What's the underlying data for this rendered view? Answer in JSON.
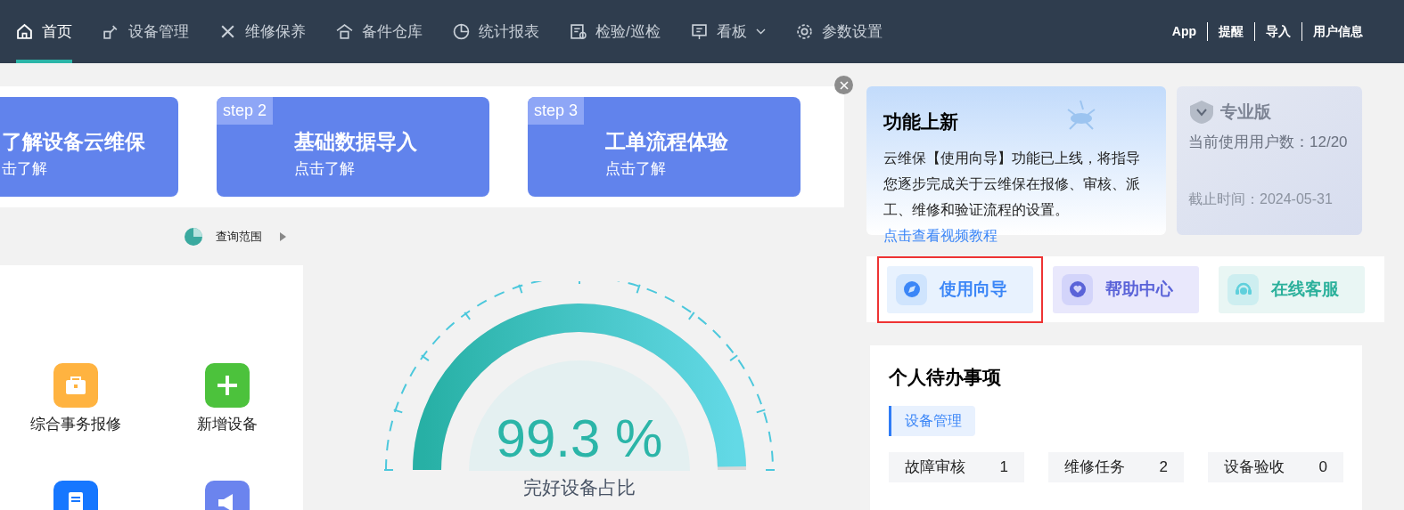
{
  "nav": {
    "items": [
      {
        "label": "首页",
        "selected": true,
        "dropdown": false
      },
      {
        "label": "设备管理",
        "selected": false,
        "dropdown": false
      },
      {
        "label": "维修保养",
        "selected": false,
        "dropdown": false
      },
      {
        "label": "备件仓库",
        "selected": false,
        "dropdown": false
      },
      {
        "label": "统计报表",
        "selected": false,
        "dropdown": false
      },
      {
        "label": "检验/巡检",
        "selected": false,
        "dropdown": false
      },
      {
        "label": "看板",
        "selected": false,
        "dropdown": true
      },
      {
        "label": "参数设置",
        "selected": false,
        "dropdown": false
      }
    ],
    "links": [
      "App",
      "提醒",
      "导入",
      "用户信息"
    ]
  },
  "steps": [
    {
      "title": "了解设备云维保",
      "subtitle": "击了解"
    },
    {
      "badge": "step 2",
      "title": "基础数据导入",
      "subtitle": "点击了解"
    },
    {
      "badge": "step 3",
      "title": "工单流程体验",
      "subtitle": "点击了解"
    }
  ],
  "query_range": {
    "label": "查询范围"
  },
  "shortcuts": [
    {
      "label": "综合事务报修",
      "color": "#ffb340"
    },
    {
      "label": "新增设备",
      "color": "#4cc23c"
    },
    {
      "color": "#1677ff"
    },
    {
      "color": "#6b84ee"
    }
  ],
  "gauge": {
    "value": "99.3 %",
    "label": "完好设备占比",
    "level": 0.993
  },
  "news": {
    "title": "功能上新",
    "body": "云维保【使用向导】功能已上线，将指导您逐步完成关于云维保在报修、审核、派工、维修和验证流程的设置。",
    "link": "点击查看视频教程"
  },
  "edition": {
    "name": "专业版",
    "users": "当前使用用户数：12/20",
    "expiry": "截止时间：2024-05-31"
  },
  "quick_actions": [
    {
      "label": "使用向导",
      "kind": "guide",
      "highlighted": true
    },
    {
      "label": "帮助中心",
      "kind": "help",
      "highlighted": false
    },
    {
      "label": "在线客服",
      "kind": "service",
      "highlighted": false
    }
  ],
  "todo": {
    "title": "个人待办事项",
    "tab": "设备管理",
    "items": [
      {
        "label": "故障审核",
        "count": "1"
      },
      {
        "label": "维修任务",
        "count": "2"
      },
      {
        "label": "设备验收",
        "count": "0"
      }
    ]
  }
}
